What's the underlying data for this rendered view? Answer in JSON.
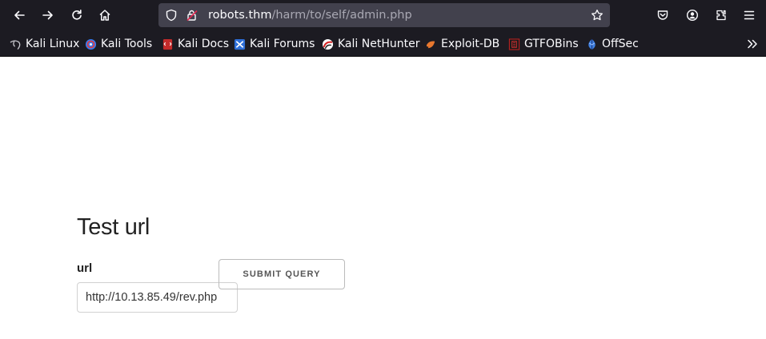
{
  "browser": {
    "url_host": "robots.thm",
    "url_path": "/harm/to/self/admin.php",
    "accent_color": "#1c1b22",
    "toolbar_icons": [
      "back-arrow-icon",
      "forward-arrow-icon",
      "reload-icon",
      "home-icon",
      "tracking-shield-icon",
      "insecure-lock-icon",
      "bookmark-star-icon",
      "pocket-icon",
      "account-icon",
      "extensions-icon",
      "menu-icon",
      "overflow-chevron-icon"
    ]
  },
  "bookmarks": [
    {
      "label": "Kali Linux",
      "icon": "kali-dragon-icon"
    },
    {
      "label": "Kali Tools",
      "icon": "kali-tools-icon"
    },
    {
      "label": "Kali Docs",
      "icon": "kali-docs-icon"
    },
    {
      "label": "Kali Forums",
      "icon": "kali-forums-icon"
    },
    {
      "label": "Kali NetHunter",
      "icon": "kali-nethunter-icon"
    },
    {
      "label": "Exploit-DB",
      "icon": "exploit-db-icon"
    },
    {
      "label": "GTFOBins",
      "icon": "gtfobins-icon"
    },
    {
      "label": "OffSec",
      "icon": "offsec-icon"
    }
  ],
  "page": {
    "title": "Test url",
    "field_label": "url",
    "input_value": "http://10.13.85.49/rev.php",
    "submit_label": "Submit Query"
  }
}
